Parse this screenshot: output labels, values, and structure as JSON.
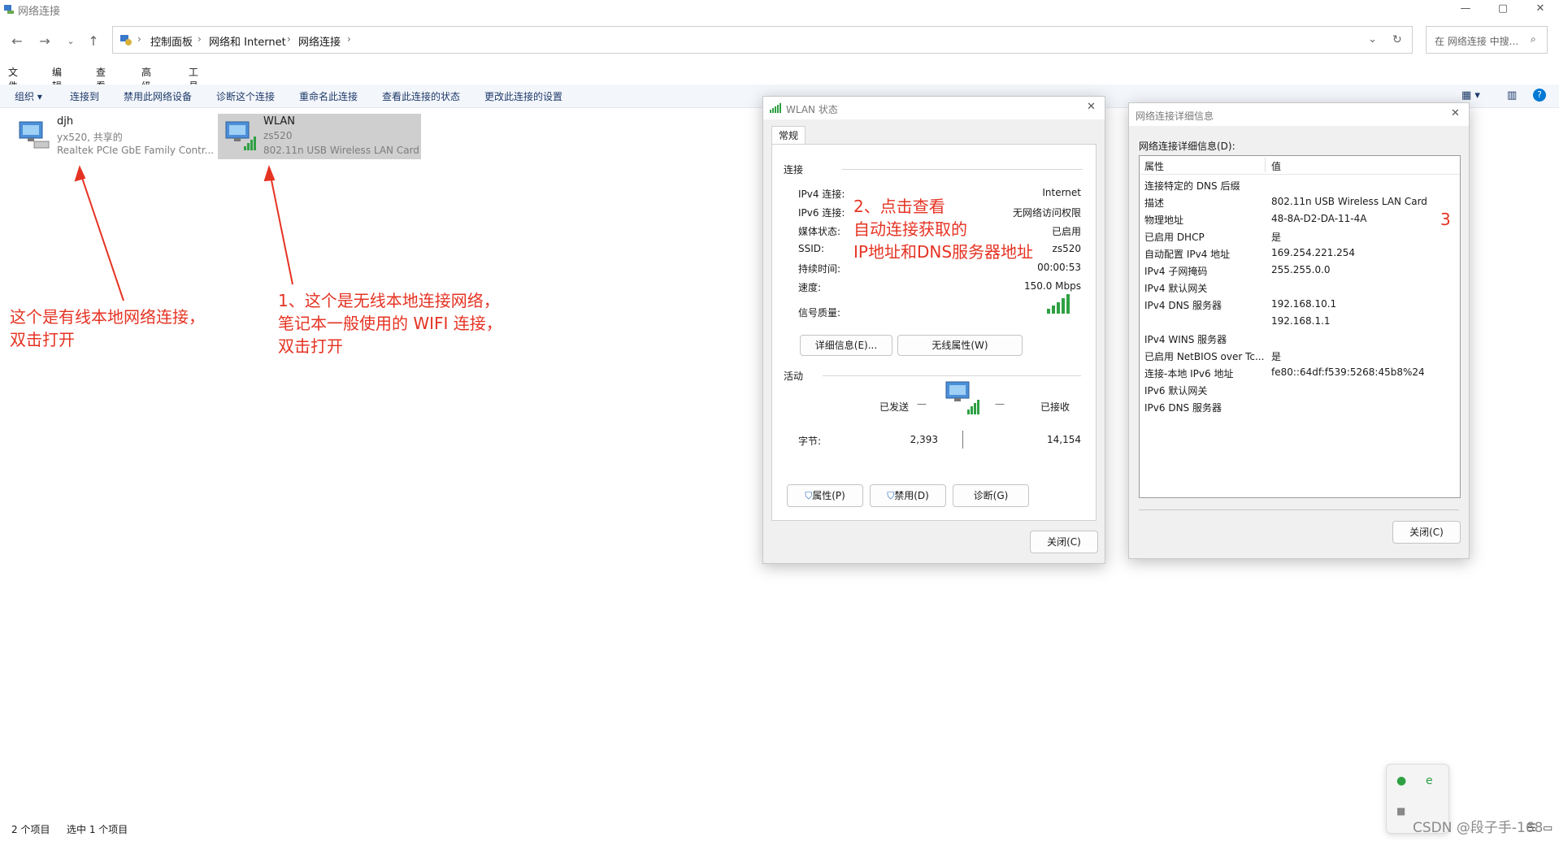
{
  "window": {
    "title": "网络连接",
    "controls": {
      "minimize": "—",
      "maximize": "▢",
      "close": "✕"
    }
  },
  "nav": {
    "breadcrumb": [
      "控制面板",
      "网络和 Internet",
      "网络连接"
    ],
    "search_placeholder": "在 网络连接 中搜..."
  },
  "menu": [
    "文件(F)",
    "编辑(E)",
    "查看(V)",
    "高级(N)",
    "工具(T)"
  ],
  "toolbar": {
    "organize": "组织 ▾",
    "items": [
      "连接到",
      "禁用此网络设备",
      "诊断这个连接",
      "重命名此连接",
      "查看此连接的状态",
      "更改此连接的设置"
    ]
  },
  "connections": [
    {
      "name": "djh",
      "line1": "yx520, 共享的",
      "line2": "Realtek PCIe GbE Family Contr..."
    },
    {
      "name": "WLAN",
      "line1": "zs520",
      "line2": "802.11n USB Wireless LAN Card"
    }
  ],
  "annotations": {
    "wired": [
      "这个是有线本地网络连接，",
      "双击打开"
    ],
    "wireless": [
      "1、这个是无线本地连接网络，",
      "笔记本一般使用的 WIFI 连接，",
      "双击打开"
    ],
    "step2": [
      "2、点击查看",
      "自动连接获取的",
      "IP地址和DNS服务器地址"
    ],
    "step3": "3"
  },
  "wlan_status": {
    "title": "WLAN 状态",
    "tab": "常规",
    "connection_header": "连接",
    "rows": [
      {
        "label": "IPv4 连接:",
        "value": "Internet"
      },
      {
        "label": "IPv6 连接:",
        "value": "无网络访问权限"
      },
      {
        "label": "媒体状态:",
        "value": "已启用"
      },
      {
        "label": "SSID:",
        "value": "zs520"
      },
      {
        "label": "持续时间:",
        "value": "00:00:53"
      },
      {
        "label": "速度:",
        "value": "150.0 Mbps"
      },
      {
        "label": "信号质量:",
        "value": ""
      }
    ],
    "details_button": "详细信息(E)...",
    "wireless_props_button": "无线属性(W)",
    "activity_header": "活动",
    "sent_label": "已发送",
    "received_label": "已接收",
    "bytes_label": "字节:",
    "bytes_sent": "2,393",
    "bytes_received": "14,154",
    "properties_button": "属性(P)",
    "disable_button": "禁用(D)",
    "diagnose_button": "诊断(G)",
    "close_button": "关闭(C)"
  },
  "details": {
    "title": "网络连接详细信息",
    "header": "网络连接详细信息(D):",
    "col_property": "属性",
    "col_value": "值",
    "rows": [
      {
        "prop": "连接特定的 DNS 后缀",
        "value": ""
      },
      {
        "prop": "描述",
        "value": "802.11n USB Wireless LAN Card"
      },
      {
        "prop": "物理地址",
        "value": "48-8A-D2-DA-11-4A"
      },
      {
        "prop": "已启用 DHCP",
        "value": "是"
      },
      {
        "prop": "自动配置 IPv4 地址",
        "value": "169.254.221.254"
      },
      {
        "prop": "IPv4 子网掩码",
        "value": "255.255.0.0"
      },
      {
        "prop": "IPv4 默认网关",
        "value": ""
      },
      {
        "prop": "IPv4 DNS 服务器",
        "value": "192.168.10.1"
      },
      {
        "prop": "",
        "value": "192.168.1.1"
      },
      {
        "prop": "IPv4 WINS 服务器",
        "value": ""
      },
      {
        "prop": "已启用 NetBIOS over Tc...",
        "value": "是"
      },
      {
        "prop": "连接-本地 IPv6 地址",
        "value": "fe80::64df:f539:5268:45b8%24"
      },
      {
        "prop": "IPv6 默认网关",
        "value": ""
      },
      {
        "prop": "IPv6 DNS 服务器",
        "value": ""
      }
    ],
    "close_button": "关闭(C)"
  },
  "statusbar": {
    "count": "2 个项目",
    "selected": "选中 1 个项目"
  },
  "watermark": "CSDN @段子手-168",
  "colors": {
    "annotation": "#e53323",
    "accent": "#0078d4",
    "signal": "#2ea043"
  }
}
